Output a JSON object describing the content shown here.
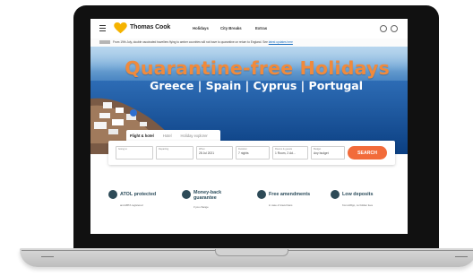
{
  "nav": {
    "brand": "Thomas Cook",
    "links": [
      "Holidays",
      "City Breaks",
      "Extras"
    ]
  },
  "notice": {
    "text": "From 19th July, double vaccinated travellers flying to amber countries will not have to quarantine on return to England. See",
    "link": "latest updates here"
  },
  "hero": {
    "title": "Quarantine-free Holidays",
    "subtitle": "Greece | Spain | Cyprus | Portugal"
  },
  "search": {
    "tabs": [
      "Flight & hotel",
      "Hotel",
      "Holiday explorer"
    ],
    "fields": [
      {
        "label": "Going to",
        "value": ""
      },
      {
        "label": "Departing",
        "value": ""
      },
      {
        "label": "When",
        "value": "28 Jul 2021"
      },
      {
        "label": "Duration",
        "value": "7 nights"
      },
      {
        "label": "Rooms & guests",
        "value": "1 Room, 2 Ad..."
      },
      {
        "label": "Budget",
        "value": "Any budget"
      }
    ],
    "button": "SEARCH"
  },
  "features": [
    {
      "title": "ATOL protected",
      "sub": "and ABTA registered",
      "icon": "shield-icon"
    },
    {
      "title": "Money-back guarantee",
      "sub": "if you change",
      "icon": "money-icon"
    },
    {
      "title": "Free amendments",
      "sub": "in case of travel bans",
      "icon": "calendar-icon"
    },
    {
      "title": "Low deposits",
      "sub": "from £30pp, no hidden fees",
      "icon": "card-icon"
    }
  ],
  "colors": {
    "accent": "#f26b3a",
    "hero_title": "#f08a3c",
    "brand_yellow": "#f5b300",
    "feature_text": "#2b4c5b"
  }
}
